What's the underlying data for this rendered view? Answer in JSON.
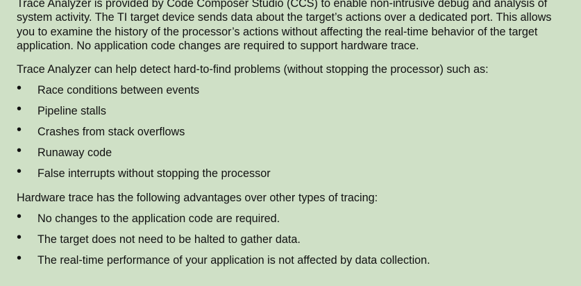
{
  "intro": "Trace Analyzer is provided by Code Composer Studio (CCS) to enable non-intrusive debug and analysis of system activity. The TI target device sends data about the target’s actions over a dedicated port. This allows you to examine the history of the processor’s actions without affecting the real-time behavior of the target application. No application code changes are required to support hardware trace.",
  "problems": {
    "lead": "Trace Analyzer can help detect hard-to-find problems (without stopping the processor) such as:",
    "items": [
      "Race conditions between events",
      "Pipeline stalls",
      "Crashes from stack overflows",
      "Runaway code",
      "False interrupts without stopping the processor"
    ]
  },
  "advantages": {
    "lead": "Hardware trace has the following advantages over other types of tracing:",
    "items": [
      "No changes to the application code are required.",
      "The target does not need to be halted to gather data.",
      "The real-time performance of your application is not affected by data collection."
    ]
  },
  "bullet_glyph": "•"
}
